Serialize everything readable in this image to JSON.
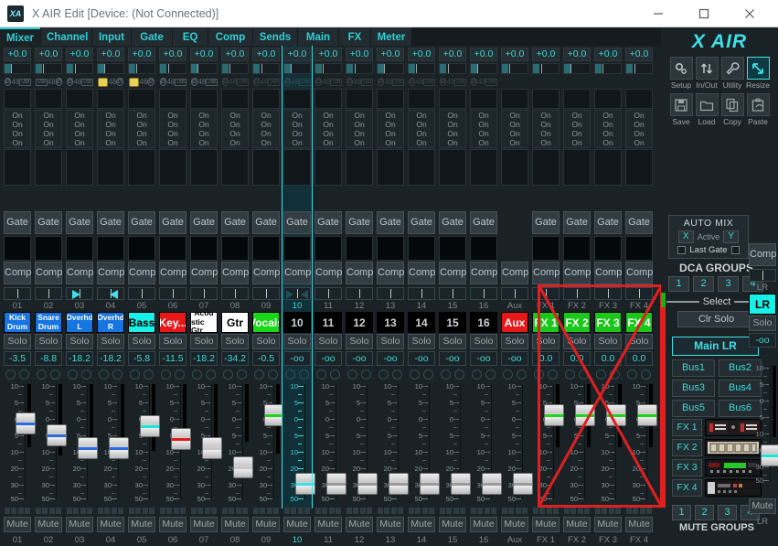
{
  "window": {
    "title": "X AIR Edit [Device: (Not Connected)]",
    "minimize": "–",
    "maximize": "☐",
    "close": "✕"
  },
  "tabs": [
    {
      "label": "Mixer",
      "active": true
    },
    {
      "label": "Channel",
      "active": false
    },
    {
      "label": "Input",
      "active": false
    },
    {
      "label": "Gate",
      "active": false
    },
    {
      "label": "EQ",
      "active": false
    },
    {
      "label": "Comp",
      "active": false
    },
    {
      "label": "Sends",
      "active": false
    },
    {
      "label": "Main",
      "active": false
    },
    {
      "label": "FX",
      "active": false
    },
    {
      "label": "Meter",
      "active": false
    }
  ],
  "labels": {
    "gain": "+0.0",
    "on": "On",
    "gate": "Gate",
    "comp": "Comp",
    "solo": "Solo",
    "mute": "Mute",
    "p48": "48",
    "pusb": "USB",
    "inf": "-oo"
  },
  "channels": [
    {
      "num": "01",
      "name1": "Kick",
      "name2": "Drum",
      "bg": "#1675e0",
      "fg": "#ffffff",
      "level": "-3.5",
      "pos": 0.3,
      "fline": "#2b6be0",
      "pan": "none",
      "sel": false,
      "phantom": "normal",
      "meter": 0.55
    },
    {
      "num": "02",
      "name1": "Snare",
      "name2": "Drum",
      "bg": "#1675e0",
      "fg": "#ffffff",
      "level": "-8.8",
      "pos": 0.43,
      "fline": "#2b6be0",
      "pan": "none",
      "sel": false,
      "phantom": "rev",
      "meter": 0.62
    },
    {
      "num": "03",
      "name1": "Overhd",
      "name2": "L",
      "bg": "#1675e0",
      "fg": "#ffffff",
      "level": "-18.2",
      "pos": 0.57,
      "fline": "#2b6be0",
      "pan": "right",
      "sel": false,
      "phantom": "normal",
      "meter": 0.6
    },
    {
      "num": "04",
      "name1": "Overhd",
      "name2": "R",
      "bg": "#1675e0",
      "fg": "#ffffff",
      "level": "-18.2",
      "pos": 0.57,
      "fline": "#2b6be0",
      "pan": "left",
      "sel": false,
      "phantom": "link",
      "meter": 0.6
    },
    {
      "num": "05",
      "name1": "Bass",
      "name2": "",
      "bg": "#19f0e8",
      "fg": "#000000",
      "level": "-5.8",
      "pos": 0.33,
      "fline": "#19e8d8",
      "pan": "none",
      "sel": false,
      "phantom": "link",
      "meter": 0.58
    },
    {
      "num": "06",
      "name1": "Key...",
      "name2": "",
      "bg": "#e81818",
      "fg": "#ffffff",
      "level": "-11.5",
      "pos": 0.47,
      "fline": "#e81818",
      "pan": "none",
      "sel": false,
      "phantom": "normal",
      "meter": 0.55
    },
    {
      "num": "07",
      "name1": "Acou",
      "name2": "stic Gtr",
      "bg": "#ffffff",
      "fg": "#000000",
      "level": "-18.2",
      "pos": 0.57,
      "fline": "#c8c8c8",
      "pan": "none",
      "sel": false,
      "phantom": "normal",
      "meter": 0.55
    },
    {
      "num": "08",
      "name1": "Gtr",
      "name2": "",
      "bg": "#ffffff",
      "fg": "#000000",
      "level": "-34.2",
      "pos": 0.77,
      "fline": "#c8c8c8",
      "pan": "none",
      "sel": false,
      "phantom": "dim",
      "meter": 0.5
    },
    {
      "num": "09",
      "name1": "Vocals",
      "name2": "",
      "bg": "#19d819",
      "fg": "#ffffff",
      "level": "-0.5",
      "pos": 0.22,
      "fline": "#19d819",
      "pan": "none",
      "sel": false,
      "phantom": "dim",
      "meter": 0.6
    },
    {
      "num": "10",
      "name1": "10",
      "name2": "",
      "bg": "#000000",
      "fg": "#c9d3d8",
      "level": "-oo",
      "pos": 0.95,
      "fline": "#3fe0e8",
      "pan": "dim",
      "sel": true,
      "phantom": "dim",
      "meter": 0.0
    },
    {
      "num": "11",
      "name1": "11",
      "name2": "",
      "bg": "#000000",
      "fg": "#c9d3d8",
      "level": "-oo",
      "pos": 0.95,
      "fline": "#9a9a9a",
      "pan": "none",
      "sel": false,
      "phantom": "dim",
      "meter": 0.0
    },
    {
      "num": "12",
      "name1": "12",
      "name2": "",
      "bg": "#000000",
      "fg": "#c9d3d8",
      "level": "-oo",
      "pos": 0.95,
      "fline": "#9a9a9a",
      "pan": "none",
      "sel": false,
      "phantom": "dim",
      "meter": 0.0
    },
    {
      "num": "13",
      "name1": "13",
      "name2": "",
      "bg": "#000000",
      "fg": "#c9d3d8",
      "level": "-oo",
      "pos": 0.95,
      "fline": "#9a9a9a",
      "pan": "none",
      "sel": false,
      "phantom": "dim",
      "meter": 0.0
    },
    {
      "num": "14",
      "name1": "14",
      "name2": "",
      "bg": "#000000",
      "fg": "#c9d3d8",
      "level": "-oo",
      "pos": 0.95,
      "fline": "#9a9a9a",
      "pan": "none",
      "sel": false,
      "phantom": "dim",
      "meter": 0.0
    },
    {
      "num": "15",
      "name1": "15",
      "name2": "",
      "bg": "#000000",
      "fg": "#c9d3d8",
      "level": "-oo",
      "pos": 0.95,
      "fline": "#9a9a9a",
      "pan": "none",
      "sel": false,
      "phantom": "dim",
      "meter": 0.0
    },
    {
      "num": "16",
      "name1": "16",
      "name2": "",
      "bg": "#000000",
      "fg": "#c9d3d8",
      "level": "-oo",
      "pos": 0.95,
      "fline": "#9a9a9a",
      "pan": "none",
      "sel": false,
      "phantom": "dim",
      "meter": 0.0
    },
    {
      "num": "Aux",
      "name1": "Aux",
      "name2": "",
      "bg": "#e81818",
      "fg": "#ffffff",
      "level": "-oo",
      "pos": 0.95,
      "fline": "#9a9a9a",
      "pan": "none",
      "sel": false,
      "phantom": "none",
      "meter": 0.0
    },
    {
      "num": "FX 1",
      "name1": "FX 1",
      "name2": "",
      "bg": "#19c819",
      "fg": "#ffffff",
      "level": "0.0",
      "pos": 0.22,
      "fline": "#19d819",
      "pan": "none",
      "sel": false,
      "phantom": "none",
      "meter": 0.55
    },
    {
      "num": "FX 2",
      "name1": "FX 2",
      "name2": "",
      "bg": "#19c819",
      "fg": "#ffffff",
      "level": "0.0",
      "pos": 0.22,
      "fline": "#19d819",
      "pan": "none",
      "sel": false,
      "phantom": "none",
      "meter": 0.55
    },
    {
      "num": "FX 3",
      "name1": "FX 3",
      "name2": "",
      "bg": "#19c819",
      "fg": "#ffffff",
      "level": "0.0",
      "pos": 0.22,
      "fline": "#19d819",
      "pan": "none",
      "sel": false,
      "phantom": "none",
      "meter": 0.55
    },
    {
      "num": "FX 4",
      "name1": "FX 4",
      "name2": "",
      "bg": "#19c819",
      "fg": "#ffffff",
      "level": "0.0",
      "pos": 0.22,
      "fline": "#19d819",
      "pan": "none",
      "sel": false,
      "phantom": "none",
      "meter": 0.55
    }
  ],
  "master": {
    "top": "LR",
    "name": "LR",
    "bg": "#19f0e8",
    "fg": "#000000",
    "level": "-oo",
    "pos": 0.84,
    "fline": "#19e8d8",
    "num": "LR",
    "gate_hidden": true
  },
  "toolbar": {
    "row1": [
      {
        "label": "Setup",
        "icon": "gears-icon",
        "active": false
      },
      {
        "label": "In/Out",
        "icon": "arrows-updown-icon",
        "active": false
      },
      {
        "label": "Utility",
        "icon": "wrench-icon",
        "active": false
      },
      {
        "label": "Resize",
        "icon": "resize-arrow-icon",
        "active": true
      }
    ],
    "row2": [
      {
        "label": "Save",
        "icon": "floppy-icon",
        "active": false
      },
      {
        "label": "Load",
        "icon": "folder-icon",
        "active": false
      },
      {
        "label": "Copy",
        "icon": "copy-icon",
        "active": false
      },
      {
        "label": "Paste",
        "icon": "paste-icon",
        "active": false
      }
    ]
  },
  "logo": "X AIR",
  "automix": {
    "title": "AUTO MIX",
    "x": "X",
    "active": "Active",
    "y": "Y",
    "lastgate": "Last Gate"
  },
  "dca": {
    "title": "DCA GROUPS",
    "buttons": [
      "1",
      "2",
      "3",
      "4"
    ]
  },
  "select_label": "Select",
  "clr_solo": "Clr Solo",
  "main_lr": "Main LR",
  "buses": [
    "Bus1",
    "Bus2",
    "Bus3",
    "Bus4",
    "Bus5",
    "Bus6"
  ],
  "fx": [
    {
      "label": "FX 1",
      "thumb": "rack-stereo-icon"
    },
    {
      "label": "FX 2",
      "thumb": "rack-beige-icon"
    },
    {
      "label": "FX 3",
      "thumb": "rack-green-icon"
    },
    {
      "label": "FX 4",
      "thumb": "rack-dark-icon"
    }
  ],
  "mute_groups": {
    "buttons": [
      "1",
      "2",
      "3",
      "4"
    ],
    "title": "MUTE GROUPS"
  },
  "scale_ticks": [
    "10",
    "5",
    "0",
    "5",
    "10",
    "20",
    "30",
    "50"
  ],
  "colors": {
    "accent": "#3fe0e8",
    "panel": "#1b2226",
    "alert": "#e02020"
  }
}
